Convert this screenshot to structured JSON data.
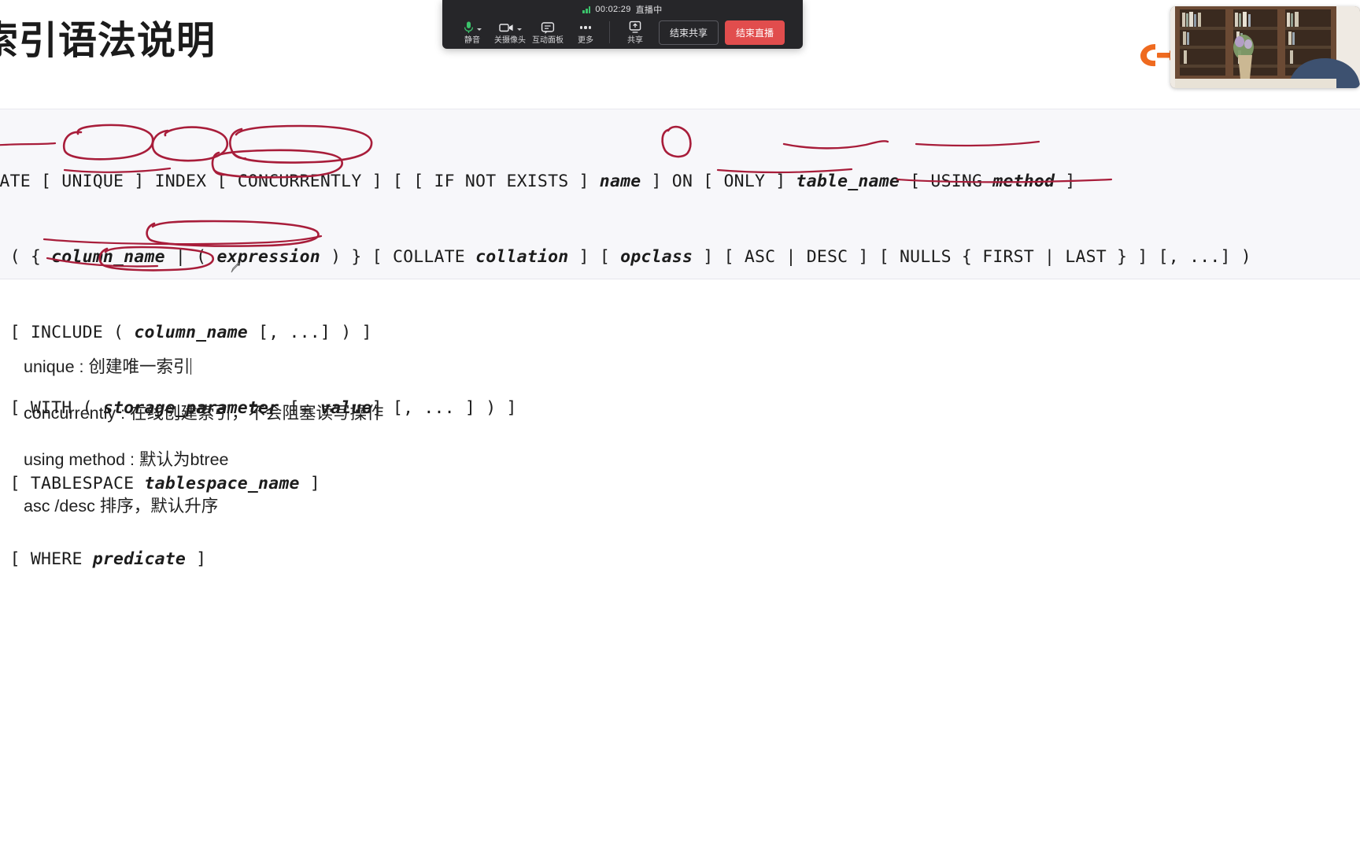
{
  "slide": {
    "title": "索引语法说明",
    "code_lines": [
      "CREATE [ UNIQUE ] INDEX [ CONCURRENTLY ] [ [ IF NOT EXISTS ] name ] ON [ ONLY ] table_name [ USING method ]",
      "    ( { column_name | ( expression ) } [ COLLATE collation ] [ opclass ] [ ASC | DESC ] [ NULLS { FIRST | LAST } ] [, ...] )",
      "    [ INCLUDE ( column_name [, ...] ) ]",
      "    [ WITH ( storage_parameter [= value] [, ... ] ) ]",
      "    [ TABLESPACE tablespace_name ]",
      "    [ WHERE predicate ]"
    ],
    "notes": [
      "unique : 创建唯一索引",
      "concurrently : 在线创建索引，不会阻塞读写操作",
      "using method : 默认为btree",
      "asc /desc 排序，默认升序"
    ],
    "annotation_color": "#a81d3a",
    "panel_bg": "#f7f7fa"
  },
  "toolbar": {
    "timer": "00:02:29",
    "live_status": "直播中",
    "signal_icon": "signal-bars-icon",
    "items": [
      {
        "label": "静音",
        "icon": "microphone-icon",
        "has_caret": true
      },
      {
        "label": "关摄像头",
        "icon": "camera-icon",
        "has_caret": true
      },
      {
        "label": "互动面板",
        "icon": "chat-panel-icon",
        "has_caret": false
      },
      {
        "label": "更多",
        "icon": "more-dots-icon",
        "has_caret": false
      },
      {
        "label": "共享",
        "icon": "screen-share-icon",
        "has_caret": false
      }
    ],
    "end_share_label": "结束共享",
    "end_live_label": "结束直播",
    "end_live_color": "#e14d4d",
    "background": "#262629"
  },
  "branding": {
    "logo_name": "orange-c-logo",
    "logo_color": "#ef6a1f"
  },
  "webcam": {
    "name": "presenter-webcam-pip"
  }
}
